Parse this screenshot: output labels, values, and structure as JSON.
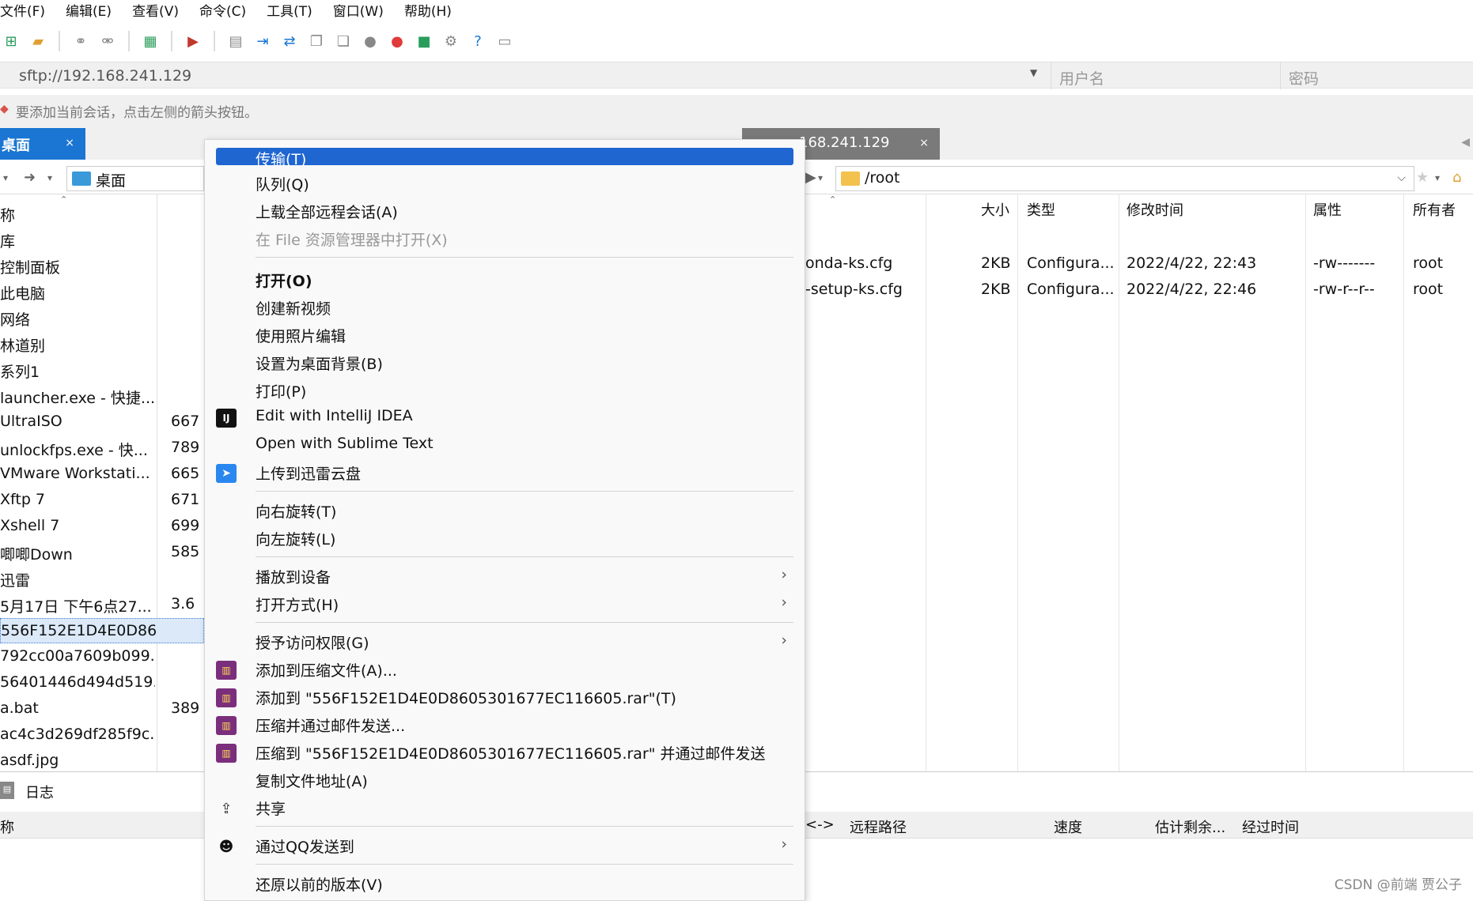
{
  "menubar": [
    "文件(F)",
    "编辑(E)",
    "查看(V)",
    "命令(C)",
    "工具(T)",
    "窗口(W)",
    "帮助(H)"
  ],
  "address": {
    "url": "sftp://192.168.241.129",
    "user_placeholder": "用户名",
    "password_placeholder": "密码"
  },
  "hint": "要添加当前会话，点击左侧的箭头按钮。",
  "tabs": {
    "left": "桌面",
    "right": "168.241.129",
    "close": "×"
  },
  "left_path": "桌面",
  "right_path": "/root",
  "left_files": [
    {
      "name": "称",
      "size": ""
    },
    {
      "name": "库",
      "size": ""
    },
    {
      "name": "控制面板",
      "size": ""
    },
    {
      "name": "此电脑",
      "size": ""
    },
    {
      "name": "网络",
      "size": ""
    },
    {
      "name": "林道别",
      "size": ""
    },
    {
      "name": "系列1",
      "size": ""
    },
    {
      "name": "launcher.exe - 快捷...",
      "size": ""
    },
    {
      "name": "UltraISO",
      "size": "667"
    },
    {
      "name": "unlockfps.exe - 快...",
      "size": "789"
    },
    {
      "name": "VMware Workstati...",
      "size": "665"
    },
    {
      "name": "Xftp 7",
      "size": "671"
    },
    {
      "name": "Xshell 7",
      "size": "699"
    },
    {
      "name": "唧唧Down",
      "size": "585"
    },
    {
      "name": "迅雷",
      "size": ""
    },
    {
      "name": "5月17日 下午6点27...",
      "size": "3.6"
    },
    {
      "name": "556F152E1D4E0D86...",
      "size": "",
      "selected": true
    },
    {
      "name": "792cc00a7609b099...",
      "size": ""
    },
    {
      "name": "56401446d494d519...",
      "size": ""
    },
    {
      "name": "a.bat",
      "size": "389"
    },
    {
      "name": "ac4c3d269df285f9c...",
      "size": ""
    },
    {
      "name": "asdf.jpg",
      "size": ""
    }
  ],
  "right_headers": [
    "大小",
    "类型",
    "修改时间",
    "属性",
    "所有者"
  ],
  "right_files": [
    {
      "name": "onda-ks.cfg",
      "size": "2KB",
      "type": "Configura...",
      "modified": "2022/4/22, 22:43",
      "attr": "-rw-------",
      "owner": "root"
    },
    {
      "name": "-setup-ks.cfg",
      "size": "2KB",
      "type": "Configura...",
      "modified": "2022/4/22, 22:46",
      "attr": "-rw-r--r--",
      "owner": "root"
    }
  ],
  "bottom": {
    "tab": "日志",
    "col_name": "称",
    "headers": [
      "<->",
      "远程路径",
      "速度",
      "估计剩余...",
      "经过时间"
    ]
  },
  "context_menu": {
    "transfer": "传输(T)",
    "queue": "队列(Q)",
    "upload_all": "上载全部远程会话(A)",
    "open_in_explorer": "在 File 资源管理器中打开(X)",
    "open": "打开(O)",
    "create_video": "创建新视频",
    "edit_photos": "使用照片编辑",
    "set_wallpaper": "设置为桌面背景(B)",
    "print": "打印(P)",
    "edit_idea": "Edit with IntelliJ IDEA",
    "open_sublime": "Open with Sublime Text",
    "upload_thunder": "上传到迅雷云盘",
    "rotate_right": "向右旋转(T)",
    "rotate_left": "向左旋转(L)",
    "cast": "播放到设备",
    "open_with": "打开方式(H)",
    "grant_access": "授予访问权限(G)",
    "add_archive": "添加到压缩文件(A)...",
    "add_rar": "添加到 \"556F152E1D4E0D8605301677EC116605.rar\"(T)",
    "compress_email": "压缩并通过邮件发送...",
    "compress_rar_email": "压缩到 \"556F152E1D4E0D8605301677EC116605.rar\" 并通过邮件发送",
    "copy_path": "复制文件地址(A)",
    "share": "共享",
    "send_qq": "通过QQ发送到",
    "restore_versions": "还原以前的版本(V)",
    "chevron": "›"
  },
  "watermark": "CSDN @前端 贾公子"
}
